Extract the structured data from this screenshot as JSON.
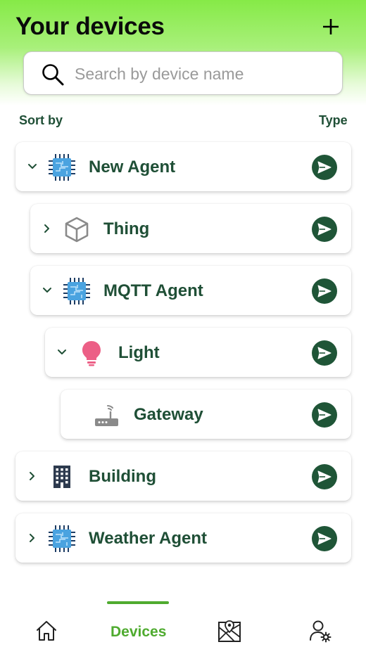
{
  "header": {
    "title": "Your devices",
    "add_icon": "plus-icon"
  },
  "search": {
    "placeholder": "Search by device name",
    "value": "",
    "icon": "search-icon"
  },
  "sort": {
    "sort_by_label": "Sort by",
    "type_label": "Type"
  },
  "devices": [
    {
      "name": "New Agent",
      "icon": "agent-chip-icon",
      "depth": 0,
      "expanded": true,
      "has_children": true
    },
    {
      "name": "Thing",
      "icon": "cube-icon",
      "depth": 1,
      "expanded": false,
      "has_children": true
    },
    {
      "name": "MQTT Agent",
      "icon": "agent-chip-icon",
      "depth": 1,
      "expanded": true,
      "has_children": true
    },
    {
      "name": "Light",
      "icon": "lightbulb-icon",
      "depth": 2,
      "expanded": true,
      "has_children": true
    },
    {
      "name": "Gateway",
      "icon": "router-icon",
      "depth": 3,
      "expanded": false,
      "has_children": false
    },
    {
      "name": "Building",
      "icon": "building-icon",
      "depth": 0,
      "expanded": false,
      "has_children": true
    },
    {
      "name": "Weather Agent",
      "icon": "agent-chip-icon",
      "depth": 0,
      "expanded": false,
      "has_children": true
    }
  ],
  "bottom_nav": {
    "items": [
      {
        "icon": "home-icon",
        "label": ""
      },
      {
        "icon": "devices-icon",
        "label": "Devices",
        "active": true
      },
      {
        "icon": "map-icon",
        "label": ""
      },
      {
        "icon": "account-settings-icon",
        "label": ""
      }
    ]
  },
  "colors": {
    "accent_green": "#4fab2f",
    "dark_green": "#1f5537",
    "header_gradient_top": "#86ea47"
  }
}
